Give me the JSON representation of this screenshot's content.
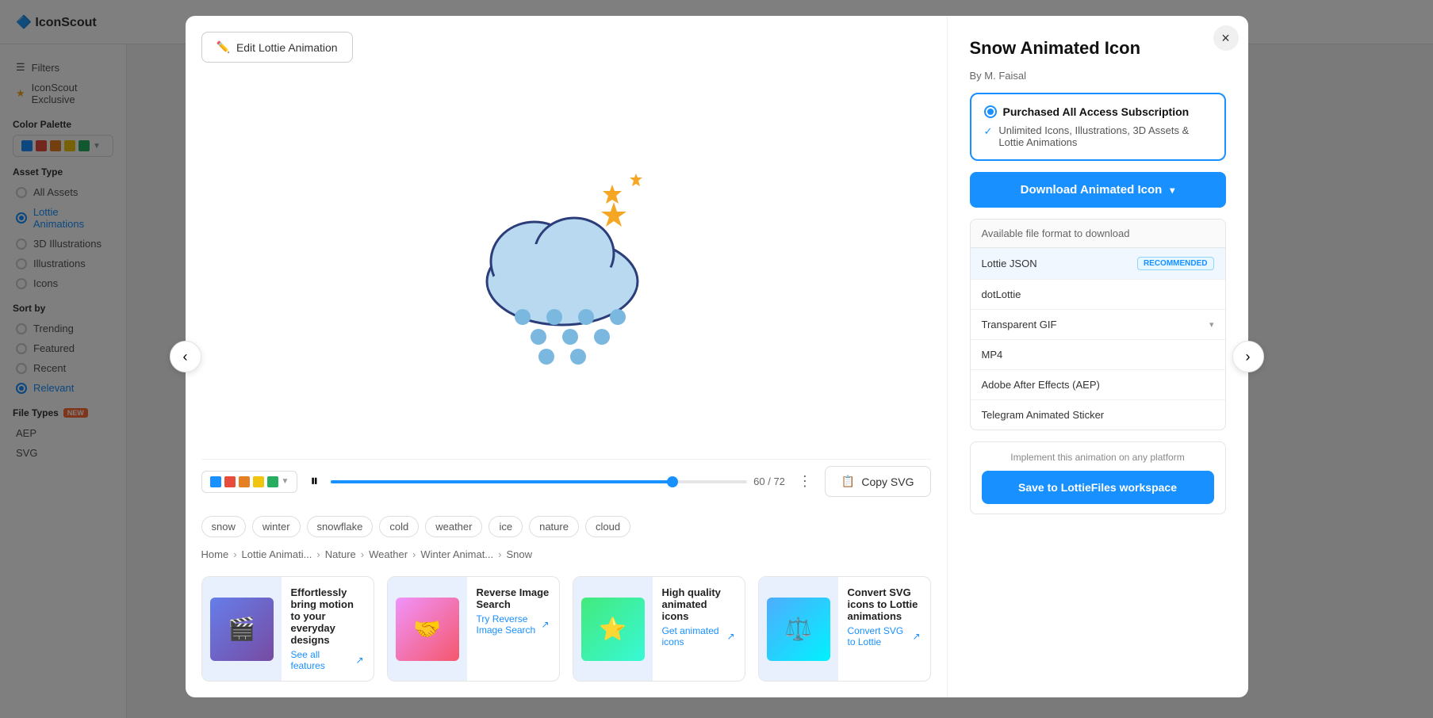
{
  "modal": {
    "title": "Snow Animated Icon",
    "author": "By M. Faisal",
    "close_label": "×",
    "edit_button": "Edit Lottie Animation",
    "copy_button": "Copy SVG",
    "frame_count": "60 / 72",
    "subscription": {
      "title": "Purchased All Access Subscription",
      "description": "Unlimited Icons, Illustrations, 3D Assets & Lottie Animations"
    },
    "download_button": "Download Animated Icon",
    "format_section": {
      "header": "Available file format to download",
      "formats": [
        {
          "name": "Lottie JSON",
          "badge": "RECOMMENDED",
          "highlighted": true
        },
        {
          "name": "dotLottie",
          "badge": "",
          "highlighted": false
        },
        {
          "name": "Transparent GIF",
          "badge": "",
          "highlighted": false,
          "has_chevron": true
        },
        {
          "name": "MP4",
          "badge": "",
          "highlighted": false
        },
        {
          "name": "Adobe After Effects (AEP)",
          "badge": "",
          "highlighted": false
        },
        {
          "name": "Telegram Animated Sticker",
          "badge": "",
          "highlighted": false
        }
      ]
    },
    "implement_text": "Implement this animation on any platform",
    "save_button": "Save to LottieFiles workspace"
  },
  "tags": [
    "snow",
    "winter",
    "snowflake",
    "cold",
    "weather",
    "ice",
    "nature",
    "cloud"
  ],
  "breadcrumb": {
    "items": [
      "Home",
      "Lottie Animati...",
      "Nature",
      "Weather",
      "Winter Animat...",
      "Snow"
    ]
  },
  "feature_cards": [
    {
      "title": "Effortlessly bring motion to your everyday designs",
      "link": "See all features",
      "color": "blue"
    },
    {
      "title": "Reverse Image Search",
      "link": "Try Reverse Image Search",
      "color": "purple"
    },
    {
      "title": "High quality animated icons",
      "link": "Get animated icons",
      "color": "green"
    },
    {
      "title": "Convert SVG icons to Lottie animations",
      "link": "Convert SVG to Lottie",
      "color": "orange"
    }
  ],
  "sidebar": {
    "filters_label": "Filters",
    "exclusive_label": "IconScout Exclusive",
    "color_palette_label": "Color Palette",
    "asset_type_label": "Asset Type",
    "asset_types": [
      {
        "label": "All Assets",
        "active": false
      },
      {
        "label": "Lottie Animations",
        "active": true
      },
      {
        "label": "3D Illustrations",
        "active": false
      },
      {
        "label": "Illustrations",
        "active": false
      },
      {
        "label": "Icons",
        "active": false
      }
    ],
    "sort_by_label": "Sort by",
    "sort_options": [
      {
        "label": "Trending",
        "active": false
      },
      {
        "label": "Featured",
        "active": false
      },
      {
        "label": "Recent",
        "active": false
      },
      {
        "label": "Relevant",
        "active": true
      }
    ],
    "file_types_label": "File Types",
    "file_types_badge": "NEW",
    "file_types": [
      "AEP",
      "SVG"
    ]
  },
  "colors": {
    "accent": "#1890ff",
    "color1": "#e74c3c",
    "color2": "#e67e22",
    "color3": "#f1c40f",
    "color4": "#27ae60"
  }
}
